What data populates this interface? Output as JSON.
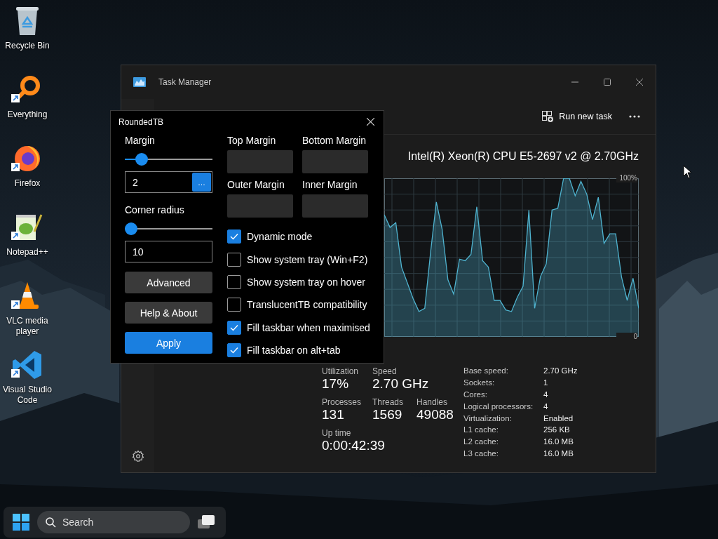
{
  "desktop_icons": [
    {
      "label": "Recycle Bin",
      "kind": "recycle",
      "shortcut": false
    },
    {
      "label": "Everything",
      "kind": "magnifier",
      "shortcut": true
    },
    {
      "label": "Firefox",
      "kind": "browser",
      "shortcut": true
    },
    {
      "label": "Notepad++",
      "kind": "notepad",
      "shortcut": true
    },
    {
      "label": "VLC media player",
      "kind": "cone",
      "shortcut": true
    },
    {
      "label": "Visual Studio Code",
      "kind": "code",
      "shortcut": true
    }
  ],
  "task_manager": {
    "title": "Task Manager",
    "run_new_task": "Run new task",
    "cpu_name": "Intel(R) Xeon(R) CPU E5-2697 v2 @ 2.70GHz",
    "chart_data": {
      "type": "area",
      "grid": true,
      "ylim": [
        0,
        100
      ],
      "yticks": [
        {
          "value": 0,
          "label": "0"
        },
        {
          "value": 100,
          "label": "100%"
        }
      ],
      "categories": [
        null,
        null,
        null,
        null,
        null,
        null,
        null,
        null,
        null,
        null,
        null,
        null,
        null,
        null,
        null,
        null,
        null,
        null,
        null,
        null,
        null,
        null,
        null,
        null,
        null,
        null,
        null,
        null,
        null,
        null,
        null,
        null,
        null,
        null,
        null,
        null,
        null,
        null,
        null,
        null,
        null,
        null,
        null,
        null,
        null
      ],
      "series": [
        {
          "color": "#4fb3cf",
          "values": [
            77,
            69,
            72,
            44,
            34,
            24,
            16,
            18,
            53,
            85,
            68,
            36,
            27,
            49,
            48,
            52,
            82,
            48,
            44,
            23,
            23,
            17,
            16,
            25,
            32,
            80,
            18,
            38,
            46,
            80,
            81,
            100,
            100,
            89,
            98,
            90,
            74,
            88,
            59,
            65,
            65,
            38,
            23,
            37,
            18
          ]
        }
      ]
    },
    "stats": [
      {
        "label": "Utilization",
        "value": "17%"
      },
      {
        "label": "Speed",
        "value": "2.70 GHz"
      }
    ],
    "counts": [
      {
        "label": "Processes",
        "value": "131"
      },
      {
        "label": "Threads",
        "value": "1569"
      },
      {
        "label": "Handles",
        "value": "49088"
      }
    ],
    "up_time": {
      "label": "Up time",
      "value": "0:00:42:39"
    },
    "details": [
      {
        "label": "Base speed:",
        "value": "2.70 GHz"
      },
      {
        "label": "Sockets:",
        "value": "1"
      },
      {
        "label": "Cores:",
        "value": "4"
      },
      {
        "label": "Logical processors:",
        "value": "4"
      },
      {
        "label": "Virtualization:",
        "value": "Enabled"
      },
      {
        "label": "L1 cache:",
        "value": "256 KB"
      },
      {
        "label": "L2 cache:",
        "value": "16.0 MB"
      },
      {
        "label": "L3 cache:",
        "value": "16.0 MB"
      }
    ]
  },
  "rounded_tb": {
    "title": "RoundedTB",
    "margin": {
      "label": "Margin",
      "level": 0.19,
      "value": "2",
      "browse": "…"
    },
    "corner_radius": {
      "label": "Corner radius",
      "level": 0.07,
      "value": "10"
    },
    "buttons": [
      {
        "label": "Advanced",
        "kind": "secondary"
      },
      {
        "label": "Help & About",
        "kind": "secondary"
      },
      {
        "label": "Apply",
        "kind": "primary"
      }
    ],
    "margin_fields": [
      {
        "label": "Top Margin"
      },
      {
        "label": "Bottom Margin"
      },
      {
        "label": "Outer Margin"
      },
      {
        "label": "Inner Margin"
      }
    ],
    "options": [
      {
        "label": "Dynamic mode",
        "checked": true
      },
      {
        "label": "Show system tray (Win+F2)",
        "checked": false
      },
      {
        "label": "Show system tray on hover",
        "checked": false
      },
      {
        "label": "TranslucentTB compatibility",
        "checked": false
      },
      {
        "label": "Fill taskbar when maximised",
        "checked": true
      },
      {
        "label": "Fill taskbar on alt+tab",
        "checked": true
      }
    ]
  },
  "taskbar": {
    "search": {
      "placeholder": "Search"
    }
  }
}
